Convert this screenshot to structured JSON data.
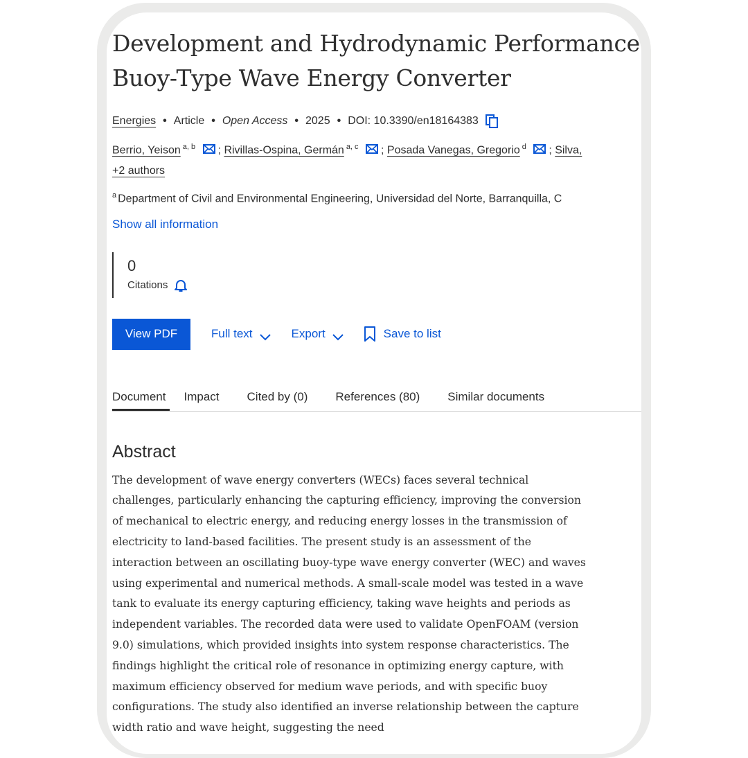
{
  "article": {
    "title_line1": "Development and Hydrodynamic Performance",
    "title_line2": "Buoy-Type Wave Energy Converter",
    "journal": "Energies",
    "type": "Article",
    "access": "Open Access",
    "year": "2025",
    "doi": "DOI: 10.3390/en18164383"
  },
  "authors": [
    {
      "name": "Berrio, Yeison",
      "sup": "a, b"
    },
    {
      "name": "Rivillas-Ospina, Germán",
      "sup": "a, c"
    },
    {
      "name": "Posada Vanegas, Gregorio",
      "sup": "d"
    },
    {
      "name": "Silva,",
      "sup": ""
    }
  ],
  "authors_more": "+2 authors",
  "affiliation": {
    "sup": "a",
    "text": "Department of Civil and Environmental Engineering, Universidad del Norte, Barranquilla, C"
  },
  "show_all": "Show all information",
  "citations": {
    "count": "0",
    "label": "Citations"
  },
  "actions": {
    "view_pdf": "View PDF",
    "full_text": "Full text",
    "export": "Export",
    "save": "Save to list"
  },
  "tabs": [
    "Document",
    "Impact",
    "Cited by (0)",
    "References (80)",
    "Similar documents"
  ],
  "abstract": {
    "heading": "Abstract",
    "text": "The development of wave energy converters (WECs) faces several technical challenges, particularly enhancing the capturing efficiency, improving the conversion of mechanical to electric energy, and reducing energy losses in the transmission of electricity to land-based facilities. The present study is an assessment of the interaction between an oscillating buoy-type wave energy converter (WEC) and waves using experimental and numerical methods. A small-scale model was tested in a wave tank to evaluate its energy capturing efficiency, taking wave heights and periods as independent variables. The recorded data were used to validate OpenFOAM (version 9.0) simulations, which provided insights into system response characteristics. The findings highlight the critical role of resonance in optimizing energy capture, with maximum efficiency observed for medium wave periods, and with specific buoy configurations. The study also identified an inverse relationship between the capture width ratio and wave height, suggesting the need"
  },
  "colors": {
    "link": "#0a57d6",
    "text": "#2e2e2e"
  }
}
